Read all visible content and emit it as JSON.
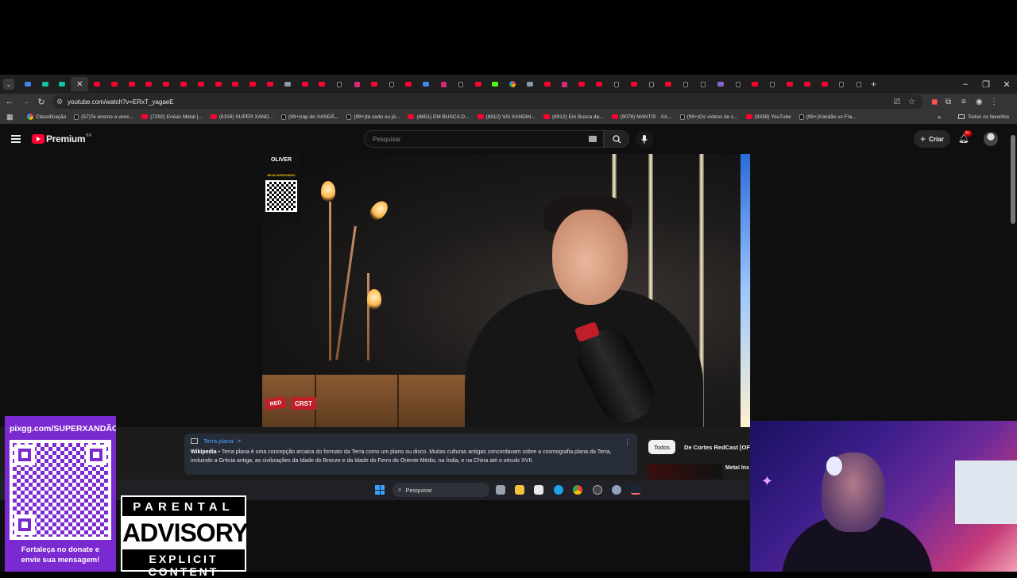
{
  "browser": {
    "tab_favicons": [
      "blue",
      "green",
      "green",
      "active",
      "yt",
      "yt",
      "yt",
      "yt",
      "yt",
      "yt",
      "yt",
      "yt",
      "yt",
      "yt",
      "yt",
      "gray",
      "yt",
      "yt",
      "tt",
      "ig",
      "yt",
      "tt",
      "yt",
      "blue",
      "ig",
      "tt",
      "yt",
      "kick",
      "google",
      "gray",
      "yt",
      "ig",
      "yt",
      "yt",
      "tt",
      "yt",
      "tt",
      "yt",
      "tt",
      "tt",
      "purple",
      "tt",
      "yt",
      "tt",
      "yt",
      "yt",
      "yt",
      "tt",
      "tt"
    ],
    "url": "youtube.com/watch?v=ERxT_yagaeE",
    "bookmarks": [
      {
        "icon": "google",
        "label": "Classificação"
      },
      {
        "icon": "tt",
        "label": "(57)Te ensino a venc..."
      },
      {
        "icon": "yt",
        "label": "(7292) Enéas Metal |..."
      },
      {
        "icon": "yt",
        "label": "(8159) SUPER XAND..."
      },
      {
        "icon": "tt",
        "label": "(99+)rap do XANDÃ..."
      },
      {
        "icon": "tt",
        "label": "(99+)tá cedo ou já..."
      },
      {
        "icon": "yt",
        "label": "(8851) EM BUSCA D..."
      },
      {
        "icon": "yt",
        "label": "(8912) VAI XANDIN..."
      },
      {
        "icon": "yt",
        "label": "(8912) Em Busca da..."
      },
      {
        "icon": "yt",
        "label": "(9078) MANTIS · XA..."
      },
      {
        "icon": "tt",
        "label": "(99+)Os vídeos de c..."
      },
      {
        "icon": "yt",
        "label": "(9338) YouTube"
      },
      {
        "icon": "tt",
        "label": "(99+)Xandão vs Fra..."
      }
    ],
    "all_bookmarks": "Todos os favoritos"
  },
  "youtube": {
    "brand": "Premium",
    "region": "BR",
    "search_placeholder": "Pesquisar",
    "create_label": "Criar",
    "notification_badge": "9+",
    "video_overlay": {
      "sponsor_name": "OLIVER",
      "sponsor_tag": "SEJA APROVADO!",
      "channel_bug_left": "RED",
      "channel_bug_right": "CRST"
    },
    "info_card": {
      "title": "Terra plana",
      "source": "Wikipedia",
      "text": "Terra plana é uma concepção arcaica do formato da Terra como um plano ou disco. Muitas culturas antigas concordavam sobre a cosmografia plana da Terra, incluindo a Grécia antiga, as civilizações da Idade do Bronze e da Idade do Ferro do Oriente Médio, na Índia, e na China até o século XVII."
    },
    "chips": [
      "Todos",
      "De Cortes RedCast [OFICIAL]"
    ],
    "recommendation_title": "Metal Ins"
  },
  "taskbar": {
    "search_label": "Pesquisar"
  },
  "overlays": {
    "pix_url": "pixgg.com/SUPERXANDÃO",
    "pix_message_line1": "Fortaleça no donate e",
    "pix_message_line2": "envie sua mensagem!",
    "advisory_line1": "PARENTAL",
    "advisory_line2": "ADVISORY",
    "advisory_line3": "EXPLICIT CONTENT"
  },
  "colors": {
    "youtube_red": "#ff0033",
    "pix_purple": "#7b2ad1",
    "link_blue": "#4da3ff"
  }
}
